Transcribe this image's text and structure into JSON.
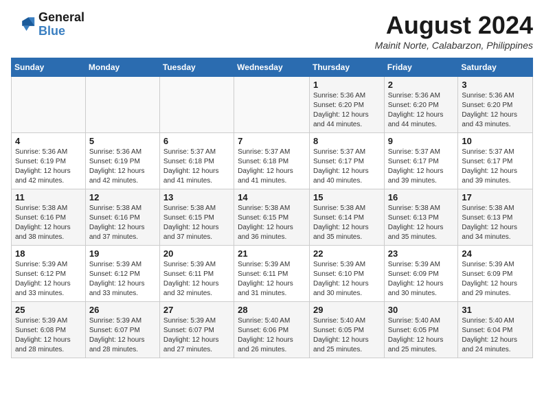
{
  "header": {
    "logo_line1": "General",
    "logo_line2": "Blue",
    "main_title": "August 2024",
    "subtitle": "Mainit Norte, Calabarzon, Philippines"
  },
  "columns": [
    "Sunday",
    "Monday",
    "Tuesday",
    "Wednesday",
    "Thursday",
    "Friday",
    "Saturday"
  ],
  "weeks": [
    [
      {
        "day": "",
        "info": ""
      },
      {
        "day": "",
        "info": ""
      },
      {
        "day": "",
        "info": ""
      },
      {
        "day": "",
        "info": ""
      },
      {
        "day": "1",
        "info": "Sunrise: 5:36 AM\nSunset: 6:20 PM\nDaylight: 12 hours\nand 44 minutes."
      },
      {
        "day": "2",
        "info": "Sunrise: 5:36 AM\nSunset: 6:20 PM\nDaylight: 12 hours\nand 44 minutes."
      },
      {
        "day": "3",
        "info": "Sunrise: 5:36 AM\nSunset: 6:20 PM\nDaylight: 12 hours\nand 43 minutes."
      }
    ],
    [
      {
        "day": "4",
        "info": "Sunrise: 5:36 AM\nSunset: 6:19 PM\nDaylight: 12 hours\nand 42 minutes."
      },
      {
        "day": "5",
        "info": "Sunrise: 5:36 AM\nSunset: 6:19 PM\nDaylight: 12 hours\nand 42 minutes."
      },
      {
        "day": "6",
        "info": "Sunrise: 5:37 AM\nSunset: 6:18 PM\nDaylight: 12 hours\nand 41 minutes."
      },
      {
        "day": "7",
        "info": "Sunrise: 5:37 AM\nSunset: 6:18 PM\nDaylight: 12 hours\nand 41 minutes."
      },
      {
        "day": "8",
        "info": "Sunrise: 5:37 AM\nSunset: 6:17 PM\nDaylight: 12 hours\nand 40 minutes."
      },
      {
        "day": "9",
        "info": "Sunrise: 5:37 AM\nSunset: 6:17 PM\nDaylight: 12 hours\nand 39 minutes."
      },
      {
        "day": "10",
        "info": "Sunrise: 5:37 AM\nSunset: 6:17 PM\nDaylight: 12 hours\nand 39 minutes."
      }
    ],
    [
      {
        "day": "11",
        "info": "Sunrise: 5:38 AM\nSunset: 6:16 PM\nDaylight: 12 hours\nand 38 minutes."
      },
      {
        "day": "12",
        "info": "Sunrise: 5:38 AM\nSunset: 6:16 PM\nDaylight: 12 hours\nand 37 minutes."
      },
      {
        "day": "13",
        "info": "Sunrise: 5:38 AM\nSunset: 6:15 PM\nDaylight: 12 hours\nand 37 minutes."
      },
      {
        "day": "14",
        "info": "Sunrise: 5:38 AM\nSunset: 6:15 PM\nDaylight: 12 hours\nand 36 minutes."
      },
      {
        "day": "15",
        "info": "Sunrise: 5:38 AM\nSunset: 6:14 PM\nDaylight: 12 hours\nand 35 minutes."
      },
      {
        "day": "16",
        "info": "Sunrise: 5:38 AM\nSunset: 6:13 PM\nDaylight: 12 hours\nand 35 minutes."
      },
      {
        "day": "17",
        "info": "Sunrise: 5:38 AM\nSunset: 6:13 PM\nDaylight: 12 hours\nand 34 minutes."
      }
    ],
    [
      {
        "day": "18",
        "info": "Sunrise: 5:39 AM\nSunset: 6:12 PM\nDaylight: 12 hours\nand 33 minutes."
      },
      {
        "day": "19",
        "info": "Sunrise: 5:39 AM\nSunset: 6:12 PM\nDaylight: 12 hours\nand 33 minutes."
      },
      {
        "day": "20",
        "info": "Sunrise: 5:39 AM\nSunset: 6:11 PM\nDaylight: 12 hours\nand 32 minutes."
      },
      {
        "day": "21",
        "info": "Sunrise: 5:39 AM\nSunset: 6:11 PM\nDaylight: 12 hours\nand 31 minutes."
      },
      {
        "day": "22",
        "info": "Sunrise: 5:39 AM\nSunset: 6:10 PM\nDaylight: 12 hours\nand 30 minutes."
      },
      {
        "day": "23",
        "info": "Sunrise: 5:39 AM\nSunset: 6:09 PM\nDaylight: 12 hours\nand 30 minutes."
      },
      {
        "day": "24",
        "info": "Sunrise: 5:39 AM\nSunset: 6:09 PM\nDaylight: 12 hours\nand 29 minutes."
      }
    ],
    [
      {
        "day": "25",
        "info": "Sunrise: 5:39 AM\nSunset: 6:08 PM\nDaylight: 12 hours\nand 28 minutes."
      },
      {
        "day": "26",
        "info": "Sunrise: 5:39 AM\nSunset: 6:07 PM\nDaylight: 12 hours\nand 28 minutes."
      },
      {
        "day": "27",
        "info": "Sunrise: 5:39 AM\nSunset: 6:07 PM\nDaylight: 12 hours\nand 27 minutes."
      },
      {
        "day": "28",
        "info": "Sunrise: 5:40 AM\nSunset: 6:06 PM\nDaylight: 12 hours\nand 26 minutes."
      },
      {
        "day": "29",
        "info": "Sunrise: 5:40 AM\nSunset: 6:05 PM\nDaylight: 12 hours\nand 25 minutes."
      },
      {
        "day": "30",
        "info": "Sunrise: 5:40 AM\nSunset: 6:05 PM\nDaylight: 12 hours\nand 25 minutes."
      },
      {
        "day": "31",
        "info": "Sunrise: 5:40 AM\nSunset: 6:04 PM\nDaylight: 12 hours\nand 24 minutes."
      }
    ]
  ]
}
